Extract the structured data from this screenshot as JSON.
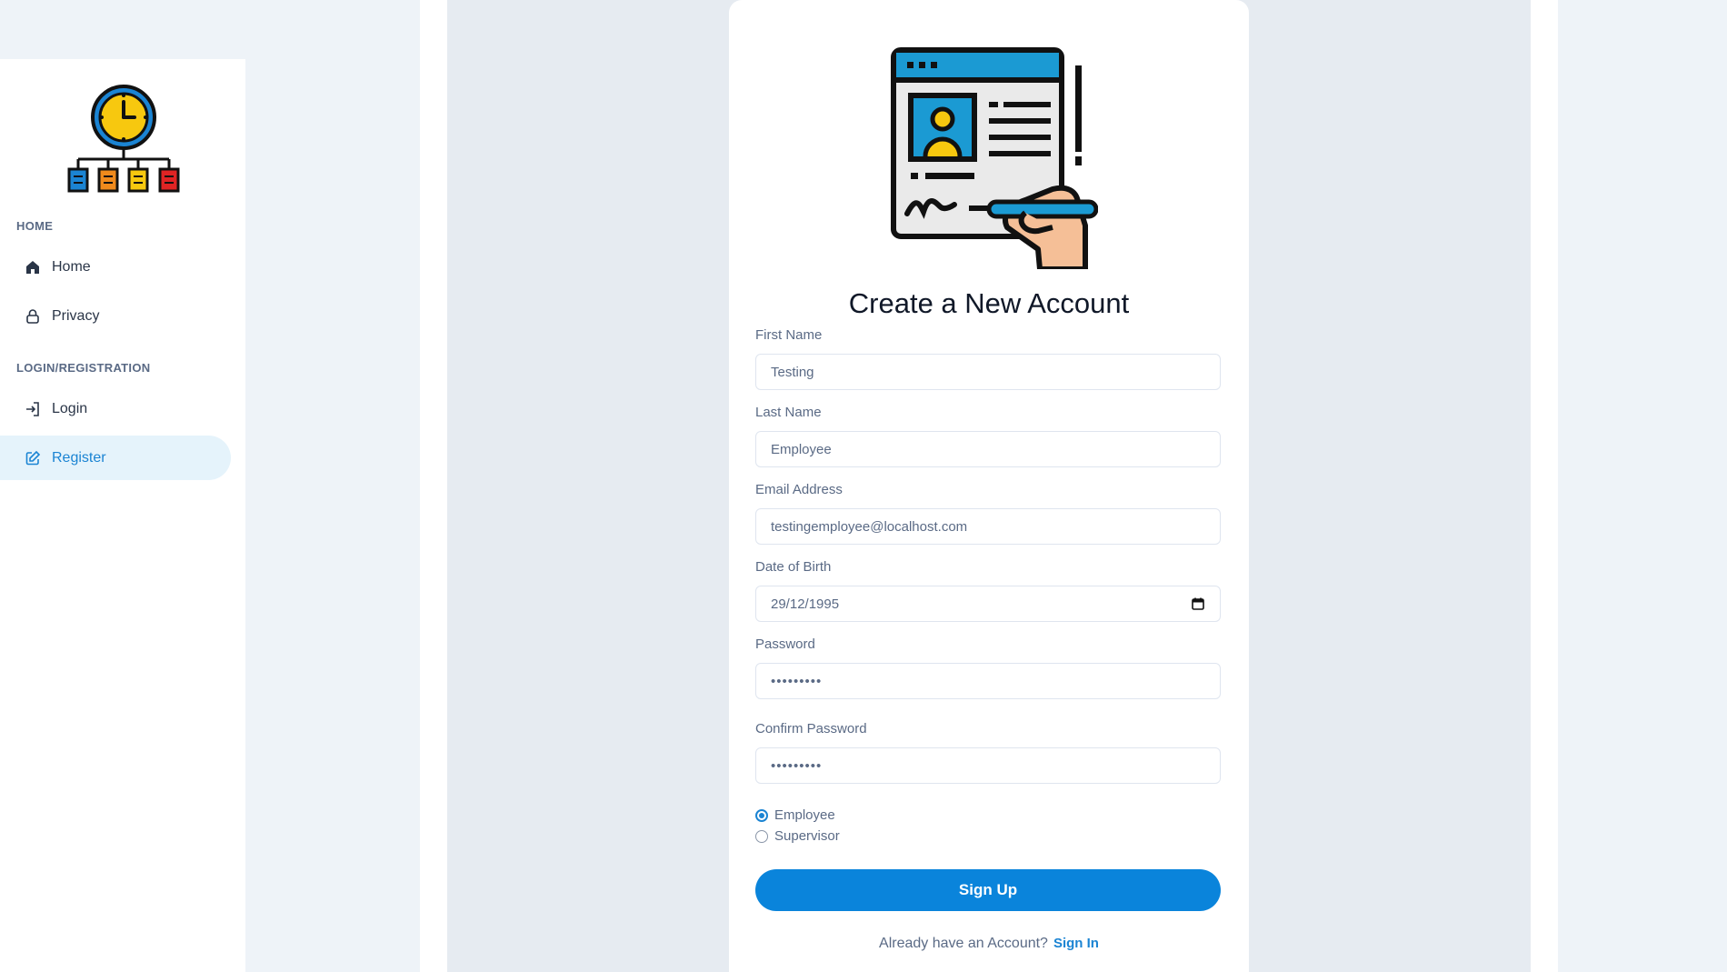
{
  "sidebar": {
    "sections": [
      {
        "caption": "HOME"
      },
      {
        "caption": "LOGIN/REGISTRATION"
      }
    ],
    "items": [
      {
        "label": "Home",
        "icon": "home-icon"
      },
      {
        "label": "Privacy",
        "icon": "lock-icon"
      },
      {
        "label": "Login",
        "icon": "login-icon"
      },
      {
        "label": "Register",
        "icon": "edit-icon",
        "active": true
      }
    ]
  },
  "form": {
    "title": "Create a New Account",
    "first_name": {
      "label": "First Name",
      "value": "Testing"
    },
    "last_name": {
      "label": "Last Name",
      "value": "Employee"
    },
    "email": {
      "label": "Email Address",
      "value": "testingemployee@localhost.com"
    },
    "dob": {
      "label": "Date of Birth",
      "value": "29/12/1995"
    },
    "password": {
      "label": "Password",
      "value": "•••••••••"
    },
    "confirm_password": {
      "label": "Confirm Password",
      "value": "•••••••••"
    },
    "roles": [
      {
        "label": "Employee",
        "checked": true
      },
      {
        "label": "Supervisor",
        "checked": false
      }
    ],
    "submit_label": "Sign Up",
    "already_text": "Already have an Account?",
    "signin_label": "Sign In"
  },
  "colors": {
    "accent": "#0a84db",
    "page_bg": "#eef3f8",
    "content_bg": "#e6ebf1"
  }
}
